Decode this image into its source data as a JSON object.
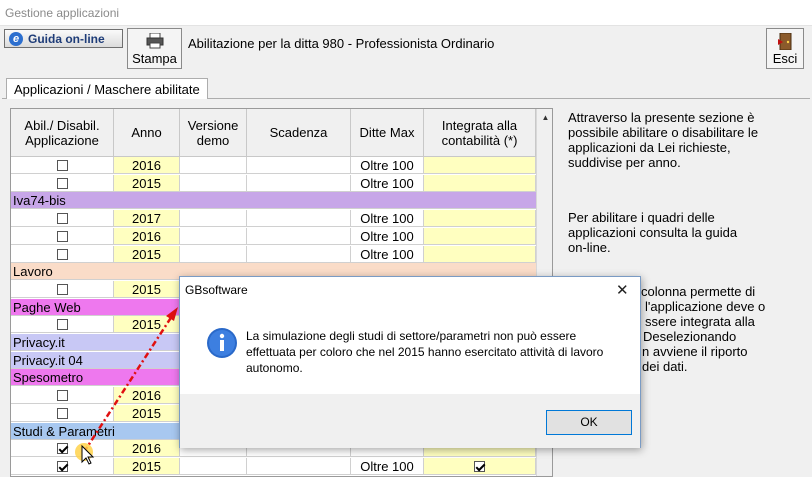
{
  "window": {
    "title": "Gestione applicazioni"
  },
  "toolbar": {
    "guida_label": "Guida on-line",
    "stampa_label": "Stampa",
    "header_text": "Abilitazione per la ditta 980 -  Professionista Ordinario",
    "esci_label": "Esci"
  },
  "tab": {
    "label": "Applicazioni / Maschere abilitate"
  },
  "grid": {
    "columns": [
      "Abil./ Disabil. Applicazione",
      "Anno",
      "Versione demo",
      "Scadenza",
      "Ditte Max",
      "Integrata alla contabilità (*)"
    ],
    "rows": [
      {
        "type": "item",
        "abil": false,
        "anno": "2016",
        "ditte": "Oltre 100",
        "integrata": false
      },
      {
        "type": "item",
        "abil": false,
        "anno": "2015",
        "ditte": "Oltre 100",
        "integrata": false
      },
      {
        "type": "group",
        "label": "Iva74-bis",
        "color": "#c7a6e8"
      },
      {
        "type": "item",
        "abil": false,
        "anno": "2017",
        "ditte": "Oltre 100",
        "integrata": false
      },
      {
        "type": "item",
        "abil": false,
        "anno": "2016",
        "ditte": "Oltre 100",
        "integrata": false
      },
      {
        "type": "item",
        "abil": false,
        "anno": "2015",
        "ditte": "Oltre 100",
        "integrata": false
      },
      {
        "type": "group",
        "label": "Lavoro",
        "color": "#fadcc8"
      },
      {
        "type": "item",
        "abil": false,
        "anno": "2015",
        "ditte": "",
        "integrata": false
      },
      {
        "type": "group",
        "label": "Paghe Web",
        "color": "#ee78ee"
      },
      {
        "type": "item",
        "abil": false,
        "anno": "2015",
        "ditte": "",
        "integrata": false
      },
      {
        "type": "group",
        "label": "Privacy.it",
        "color": "#c8c8f5"
      },
      {
        "type": "group",
        "label": "Privacy.it 04",
        "color": "#c8c8f5"
      },
      {
        "type": "group",
        "label": "Spesometro",
        "color": "#ee78ee"
      },
      {
        "type": "item",
        "abil": false,
        "anno": "2016",
        "ditte": "",
        "integrata": false
      },
      {
        "type": "item",
        "abil": false,
        "anno": "2015",
        "ditte": "",
        "integrata": false
      },
      {
        "type": "group",
        "label": "Studi & Parametri",
        "color": "#a8c8f0"
      },
      {
        "type": "item",
        "abil": true,
        "anno": "2016",
        "ditte": "",
        "integrata": false
      },
      {
        "type": "item",
        "abil": true,
        "anno": "2015",
        "ditte": "Oltre 100",
        "integrata": true
      }
    ]
  },
  "info": {
    "p1": [
      "Attraverso la presente sezione è",
      "possibile abilitare o disabilitare le",
      "applicazioni da Lei richieste,",
      "suddivise per anno."
    ],
    "p2": [
      "Per abilitare i quadri delle",
      "applicazioni consulta la guida",
      "on-line."
    ],
    "p3": [
      "colonna permette di",
      "l'applicazione deve o",
      "ssere integrata alla",
      "Deselezionando",
      "n avviene il riporto",
      "dei dati."
    ]
  },
  "dialog": {
    "title": "GBsoftware",
    "close_glyph": "✕",
    "message": "La simulazione degli studi di settore/parametri non può essere effettuata per coloro che nel 2015 hanno esercitato attività di lavoro autonomo.",
    "ok_label": "OK"
  },
  "colors": {
    "year_cell": "#ffffc0",
    "row_bg": "#ffffff",
    "annotation_arrow": "#e01010"
  }
}
